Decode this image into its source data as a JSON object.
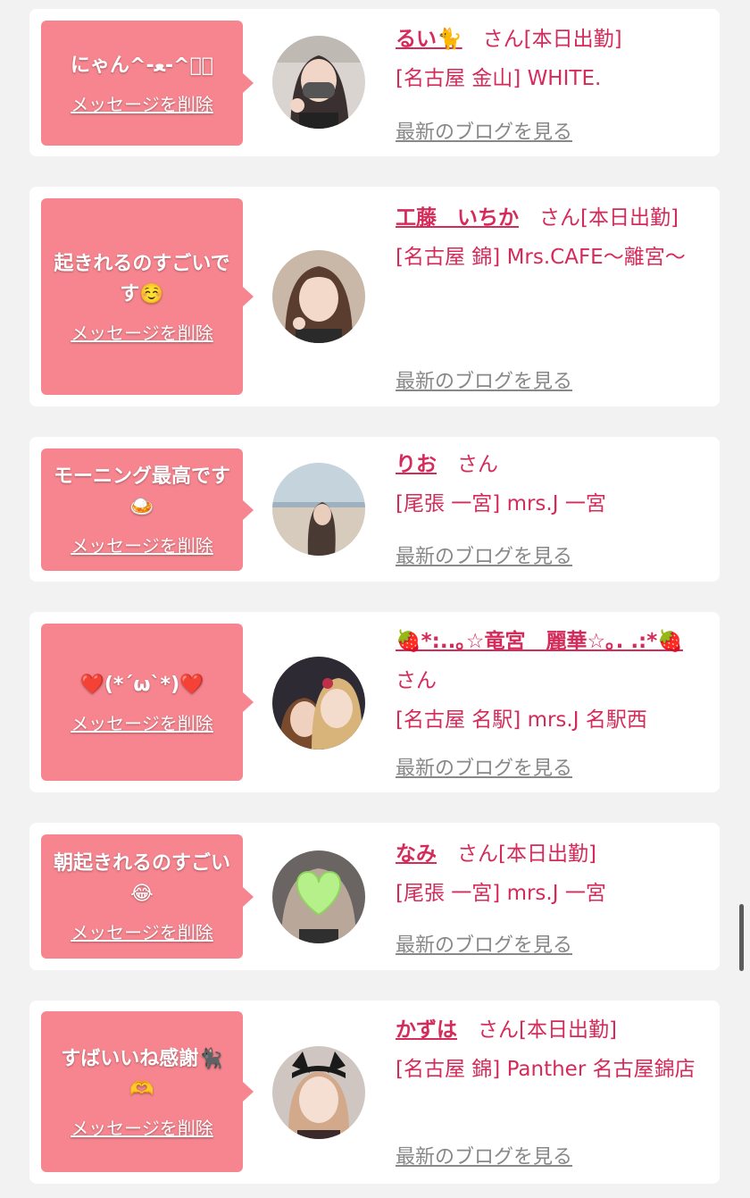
{
  "delete_label": "メッセージを削除",
  "blog_label": "最新のブログを見る",
  "san_label": "さん",
  "colors": {
    "bubble": "#f6858f",
    "name": "#d42b5a",
    "blog_link": "#888888"
  },
  "cards": [
    {
      "message": "にゃん^-ﻌ-^ฅ゙",
      "name": "るい🐈",
      "status": "[本日出勤]",
      "shop": "[名古屋 金山] WHITE.",
      "avatar_icon": "girl-photo"
    },
    {
      "message": "起きれるのすごいです☺️",
      "name": "工藤　いちか",
      "status": "[本日出勤]",
      "shop": "[名古屋 錦] Mrs.CAFE〜離宮〜",
      "avatar_icon": "girl-photo"
    },
    {
      "message": "モーニング最高です🍛",
      "name": "りお",
      "status": "",
      "shop": "[尾張 一宮] mrs.J 一宮",
      "avatar_icon": "beach-photo"
    },
    {
      "message": "❤️(*´ω`*)❤️",
      "name": "🍓*:..｡☆竜宮　麗華☆｡. .:*🍓",
      "status": "",
      "shop": "[名古屋 名駅] mrs.J 名駅西",
      "avatar_icon": "two-girls-photo"
    },
    {
      "message": "朝起きれるのすごい😂",
      "name": "なみ",
      "status": "[本日出勤]",
      "shop": "[尾張 一宮] mrs.J 一宮",
      "avatar_icon": "heart-face-photo"
    },
    {
      "message": "すばいいね感謝🐈‍⬛🫶",
      "name": "かずは",
      "status": "[本日出勤]",
      "shop": "[名古屋 錦] Panther 名古屋錦店",
      "avatar_icon": "cat-ears-photo"
    }
  ]
}
